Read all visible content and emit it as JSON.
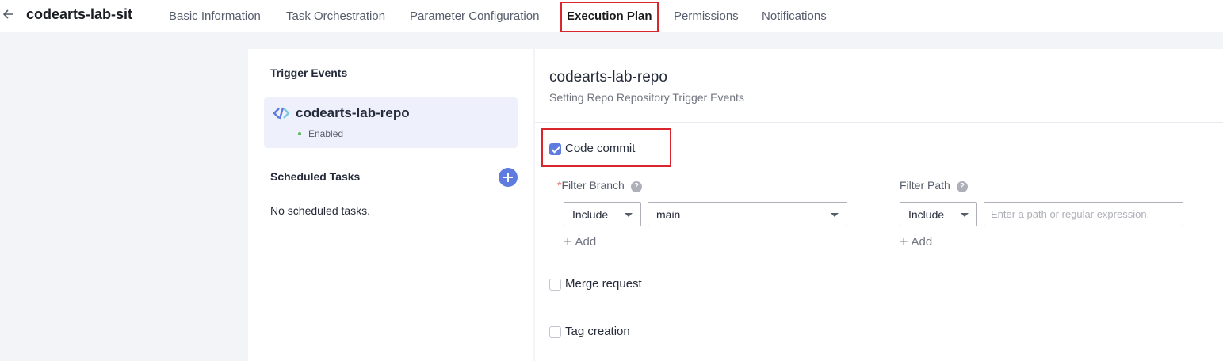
{
  "header": {
    "title": "codearts-lab-sit",
    "tabs": [
      {
        "label": "Basic Information"
      },
      {
        "label": "Task Orchestration"
      },
      {
        "label": "Parameter Configuration"
      },
      {
        "label": "Execution Plan"
      },
      {
        "label": "Permissions"
      },
      {
        "label": "Notifications"
      }
    ],
    "active_tab": "Execution Plan"
  },
  "left_panel": {
    "trigger_events_title": "Trigger Events",
    "trigger": {
      "name": "codearts-lab-repo",
      "status": "Enabled",
      "icon": "repo-link-icon"
    },
    "scheduled_tasks_title": "Scheduled Tasks",
    "scheduled_empty": "No scheduled tasks."
  },
  "right_panel": {
    "title": "codearts-lab-repo",
    "subtitle": "Setting Repo Repository Trigger Events",
    "code_commit": {
      "label": "Code commit",
      "checked": true
    },
    "filter_branch": {
      "required_mark": "*",
      "label": "Filter Branch",
      "mode": "Include",
      "value": "main",
      "add_label": "Add"
    },
    "filter_path": {
      "label": "Filter Path",
      "mode": "Include",
      "placeholder": "Enter a path or regular expression.",
      "add_label": "Add"
    },
    "merge_request": {
      "label": "Merge request",
      "checked": false
    },
    "tag_creation": {
      "label": "Tag creation",
      "checked": false
    }
  },
  "colors": {
    "accent": "#5e7ce0",
    "highlight": "#d8262c",
    "enabled": "#5cb85c"
  }
}
